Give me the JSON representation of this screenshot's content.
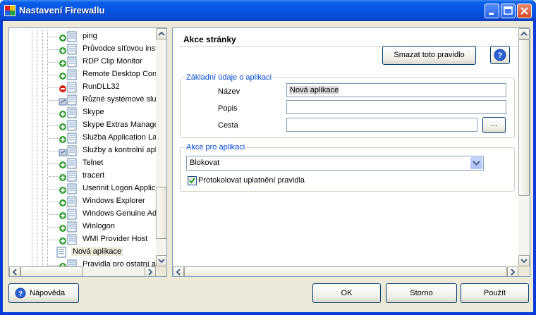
{
  "window": {
    "title": "Nastavení Firewallu",
    "minimize_label": "Minimize",
    "maximize_label": "Maximize",
    "close_label": "Close"
  },
  "tree": {
    "items": [
      {
        "label": "ping",
        "icon": "app-allow-icon"
      },
      {
        "label": "Průvodce síťovou instalací",
        "icon": "app-allow-icon"
      },
      {
        "label": "RDP Clip Monitor",
        "icon": "app-allow-icon"
      },
      {
        "label": "Remote Desktop Connection",
        "icon": "app-allow-icon"
      },
      {
        "label": "RunDLL32",
        "icon": "app-block-icon"
      },
      {
        "label": "Různé systémové služby",
        "icon": "app-advanced-icon"
      },
      {
        "label": "Skype",
        "icon": "app-allow-icon"
      },
      {
        "label": "Skype Extras Manager",
        "icon": "app-allow-icon"
      },
      {
        "label": "Služba Application Layer Gateway",
        "icon": "app-allow-icon"
      },
      {
        "label": "Služby a kontrolní aplikace",
        "icon": "app-advanced-icon"
      },
      {
        "label": "Telnet",
        "icon": "app-allow-icon"
      },
      {
        "label": "tracert",
        "icon": "app-allow-icon"
      },
      {
        "label": "Userinit Logon Application",
        "icon": "app-allow-icon"
      },
      {
        "label": "Windows Explorer",
        "icon": "app-allow-icon"
      },
      {
        "label": "Windows Genuine Advantage",
        "icon": "app-allow-icon"
      },
      {
        "label": "Winlogon",
        "icon": "app-allow-icon"
      },
      {
        "label": "WMI Provider Host",
        "icon": "app-allow-icon"
      },
      {
        "label": "Nová aplikace",
        "icon": "page-icon",
        "selected": true
      },
      {
        "label": "Pravidla pro ostatní aplikace",
        "icon": "app-allow-icon"
      }
    ]
  },
  "page": {
    "title": "Akce stránky",
    "delete_rule_label": "Smazat toto pravidlo",
    "help_icon": "help-icon",
    "app_info": {
      "legend": "Základní údaje o aplikaci",
      "name_label": "Název",
      "name_value": "Nová aplikace",
      "description_label": "Popis",
      "description_value": "",
      "path_label": "Cesta",
      "path_value": "",
      "browse_label": "..."
    },
    "app_action": {
      "legend": "Akce pro aplikaci",
      "action_value": "Blokovat",
      "log_label": "Protokolovat uplatnění pravidla",
      "log_checked": true
    }
  },
  "buttons": {
    "help": "Nápověda",
    "ok": "OK",
    "cancel": "Storno",
    "apply": "Použít"
  },
  "colors": {
    "titlebar": "#0755e3",
    "window_bg": "#ece9d8",
    "legend_text": "#0046d5",
    "border": "#7f9db9"
  }
}
